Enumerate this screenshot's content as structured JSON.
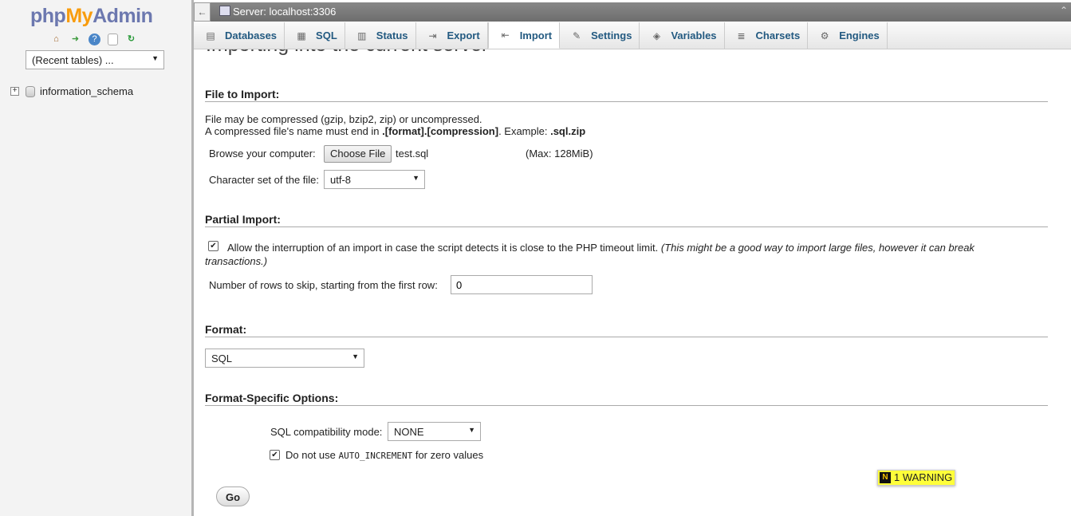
{
  "nav": {
    "logo": {
      "php": "php",
      "my": "My",
      "admin": "Admin"
    },
    "icons": [
      "home-icon",
      "logout-icon",
      "help-icon",
      "docs-icon",
      "reload-icon"
    ],
    "recent_tables": "(Recent tables) ...",
    "databases": [
      {
        "name": "information_schema"
      }
    ]
  },
  "topbar": {
    "back": "←",
    "server": "Server: localhost:3306"
  },
  "tabs": [
    {
      "label": "Databases",
      "icon": "database-icon"
    },
    {
      "label": "SQL",
      "icon": "sql-icon"
    },
    {
      "label": "Status",
      "icon": "status-icon"
    },
    {
      "label": "Export",
      "icon": "export-icon"
    },
    {
      "label": "Import",
      "icon": "import-icon",
      "active": true
    },
    {
      "label": "Settings",
      "icon": "settings-icon"
    },
    {
      "label": "Variables",
      "icon": "variables-icon"
    },
    {
      "label": "Charsets",
      "icon": "charsets-icon"
    },
    {
      "label": "Engines",
      "icon": "engines-icon"
    }
  ],
  "main": {
    "heading": "Importing into the current server",
    "file_section": {
      "legend": "File to Import:",
      "line1": "File may be compressed (gzip, bzip2, zip) or uncompressed.",
      "line2_pre": "A compressed file's name must end in ",
      "line2_bold": ".[format].[compression]",
      "line2_mid": ". Example: ",
      "line2_example": ".sql.zip",
      "browse_label": "Browse your computer:",
      "choose_file": "Choose File",
      "file_name": "test.sql",
      "max_size": "(Max: 128MiB)",
      "charset_label": "Character set of the file:",
      "charset_value": "utf-8"
    },
    "partial_section": {
      "legend": "Partial Import:",
      "allow_checked": true,
      "allow_text": "Allow the interruption of an import in case the script detects it is close to the PHP timeout limit.",
      "allow_note": "(This might be a good way to import large files, however it can break transactions.)",
      "skip_label": "Number of rows to skip, starting from the first row:",
      "skip_value": "0"
    },
    "format_section": {
      "legend": "Format:",
      "format_value": "SQL"
    },
    "options_section": {
      "legend": "Format-Specific Options:",
      "compat_label": "SQL compatibility mode:",
      "compat_value": "NONE",
      "auto_inc_checked": true,
      "auto_inc_pre": "Do not use ",
      "auto_inc_code": "AUTO_INCREMENT",
      "auto_inc_post": " for zero values"
    },
    "go_label": "Go",
    "warning": {
      "text": "1 WARNING",
      "icon": "warning-badge-icon"
    }
  },
  "colors": {
    "tab_text": "#235a81",
    "logo_blue": "#6c78af",
    "logo_orange": "#f89c0e",
    "warning_bg": "#ffff3a"
  }
}
